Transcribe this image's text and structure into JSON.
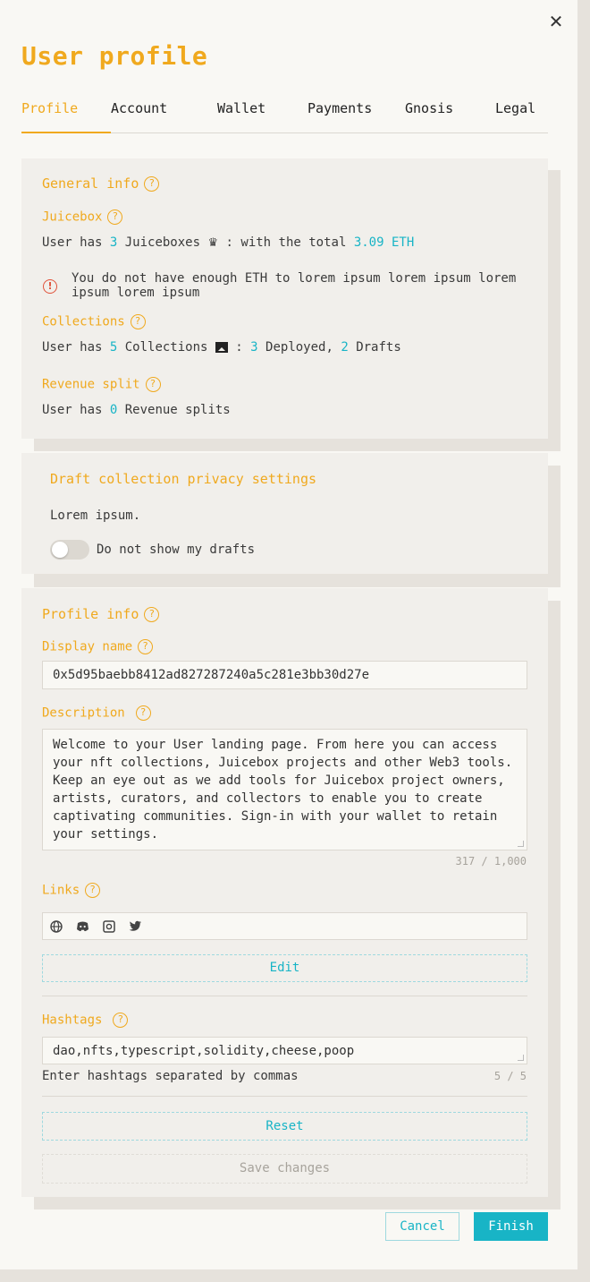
{
  "header": {
    "title": "User profile",
    "close_icon": "close-icon"
  },
  "tabs": [
    {
      "label": "Profile",
      "active": true
    },
    {
      "label": "Account",
      "active": false
    },
    {
      "label": "Wallet",
      "active": false
    },
    {
      "label": "Payments",
      "active": false
    },
    {
      "label": "Gnosis",
      "active": false
    },
    {
      "label": "Legal",
      "active": false
    }
  ],
  "general_info": {
    "title": "General info",
    "juicebox": {
      "label": "Juicebox",
      "prefix": "User has ",
      "count": "3",
      "mid": " Juiceboxes ",
      "suffix": " : with the total ",
      "total": "3.09 ETH"
    },
    "warning": "You do not have enough ETH to lorem ipsum lorem ipsum lorem ipsum lorem ipsum",
    "collections": {
      "label": "Collections",
      "prefix": "User has ",
      "count": "5",
      "mid": " Collections ",
      "sep": " : ",
      "deployed": "3",
      "deployed_label": " Deployed, ",
      "drafts": "2",
      "drafts_label": " Drafts"
    },
    "revenue": {
      "label": "Revenue split",
      "prefix": "User has ",
      "count": "0",
      "suffix": " Revenue splits"
    }
  },
  "privacy": {
    "title": "Draft collection privacy settings",
    "description": "Lorem ipsum.",
    "toggle_label": "Do not show my drafts",
    "toggle_on": false
  },
  "profile_info": {
    "title": "Profile info",
    "display_name_label": "Display name",
    "display_name_value": "0x5d95baebb8412ad827287240a5c281e3bb30d27e",
    "description_label": "Description",
    "description_value": "Welcome to your User landing page. From here you can access your nft collections, Juicebox projects and other Web3 tools.  Keep an eye out as we add tools for Juicebox project owners, artists, curators, and collectors to enable you to create captivating communities.  Sign-in with your wallet to retain your settings.",
    "description_counter": "317 / 1,000",
    "links_label": "Links",
    "link_icons": [
      "globe-icon",
      "discord-icon",
      "instagram-icon",
      "twitter-icon"
    ],
    "edit_label": "Edit",
    "hashtags_label": "Hashtags",
    "hashtags_value": "dao,nfts,typescript,solidity,cheese,poop",
    "hashtags_hint": "Enter hashtags separated by commas",
    "hashtags_counter": "5 / 5",
    "reset_label": "Reset",
    "save_label": "Save changes"
  },
  "footer": {
    "cancel_label": "Cancel",
    "finish_label": "Finish"
  },
  "colors": {
    "accent": "#f0a91e",
    "link": "#18b4c6",
    "warning": "#e0523b",
    "background": "#f9f8f4",
    "card": "#f1efeb"
  }
}
